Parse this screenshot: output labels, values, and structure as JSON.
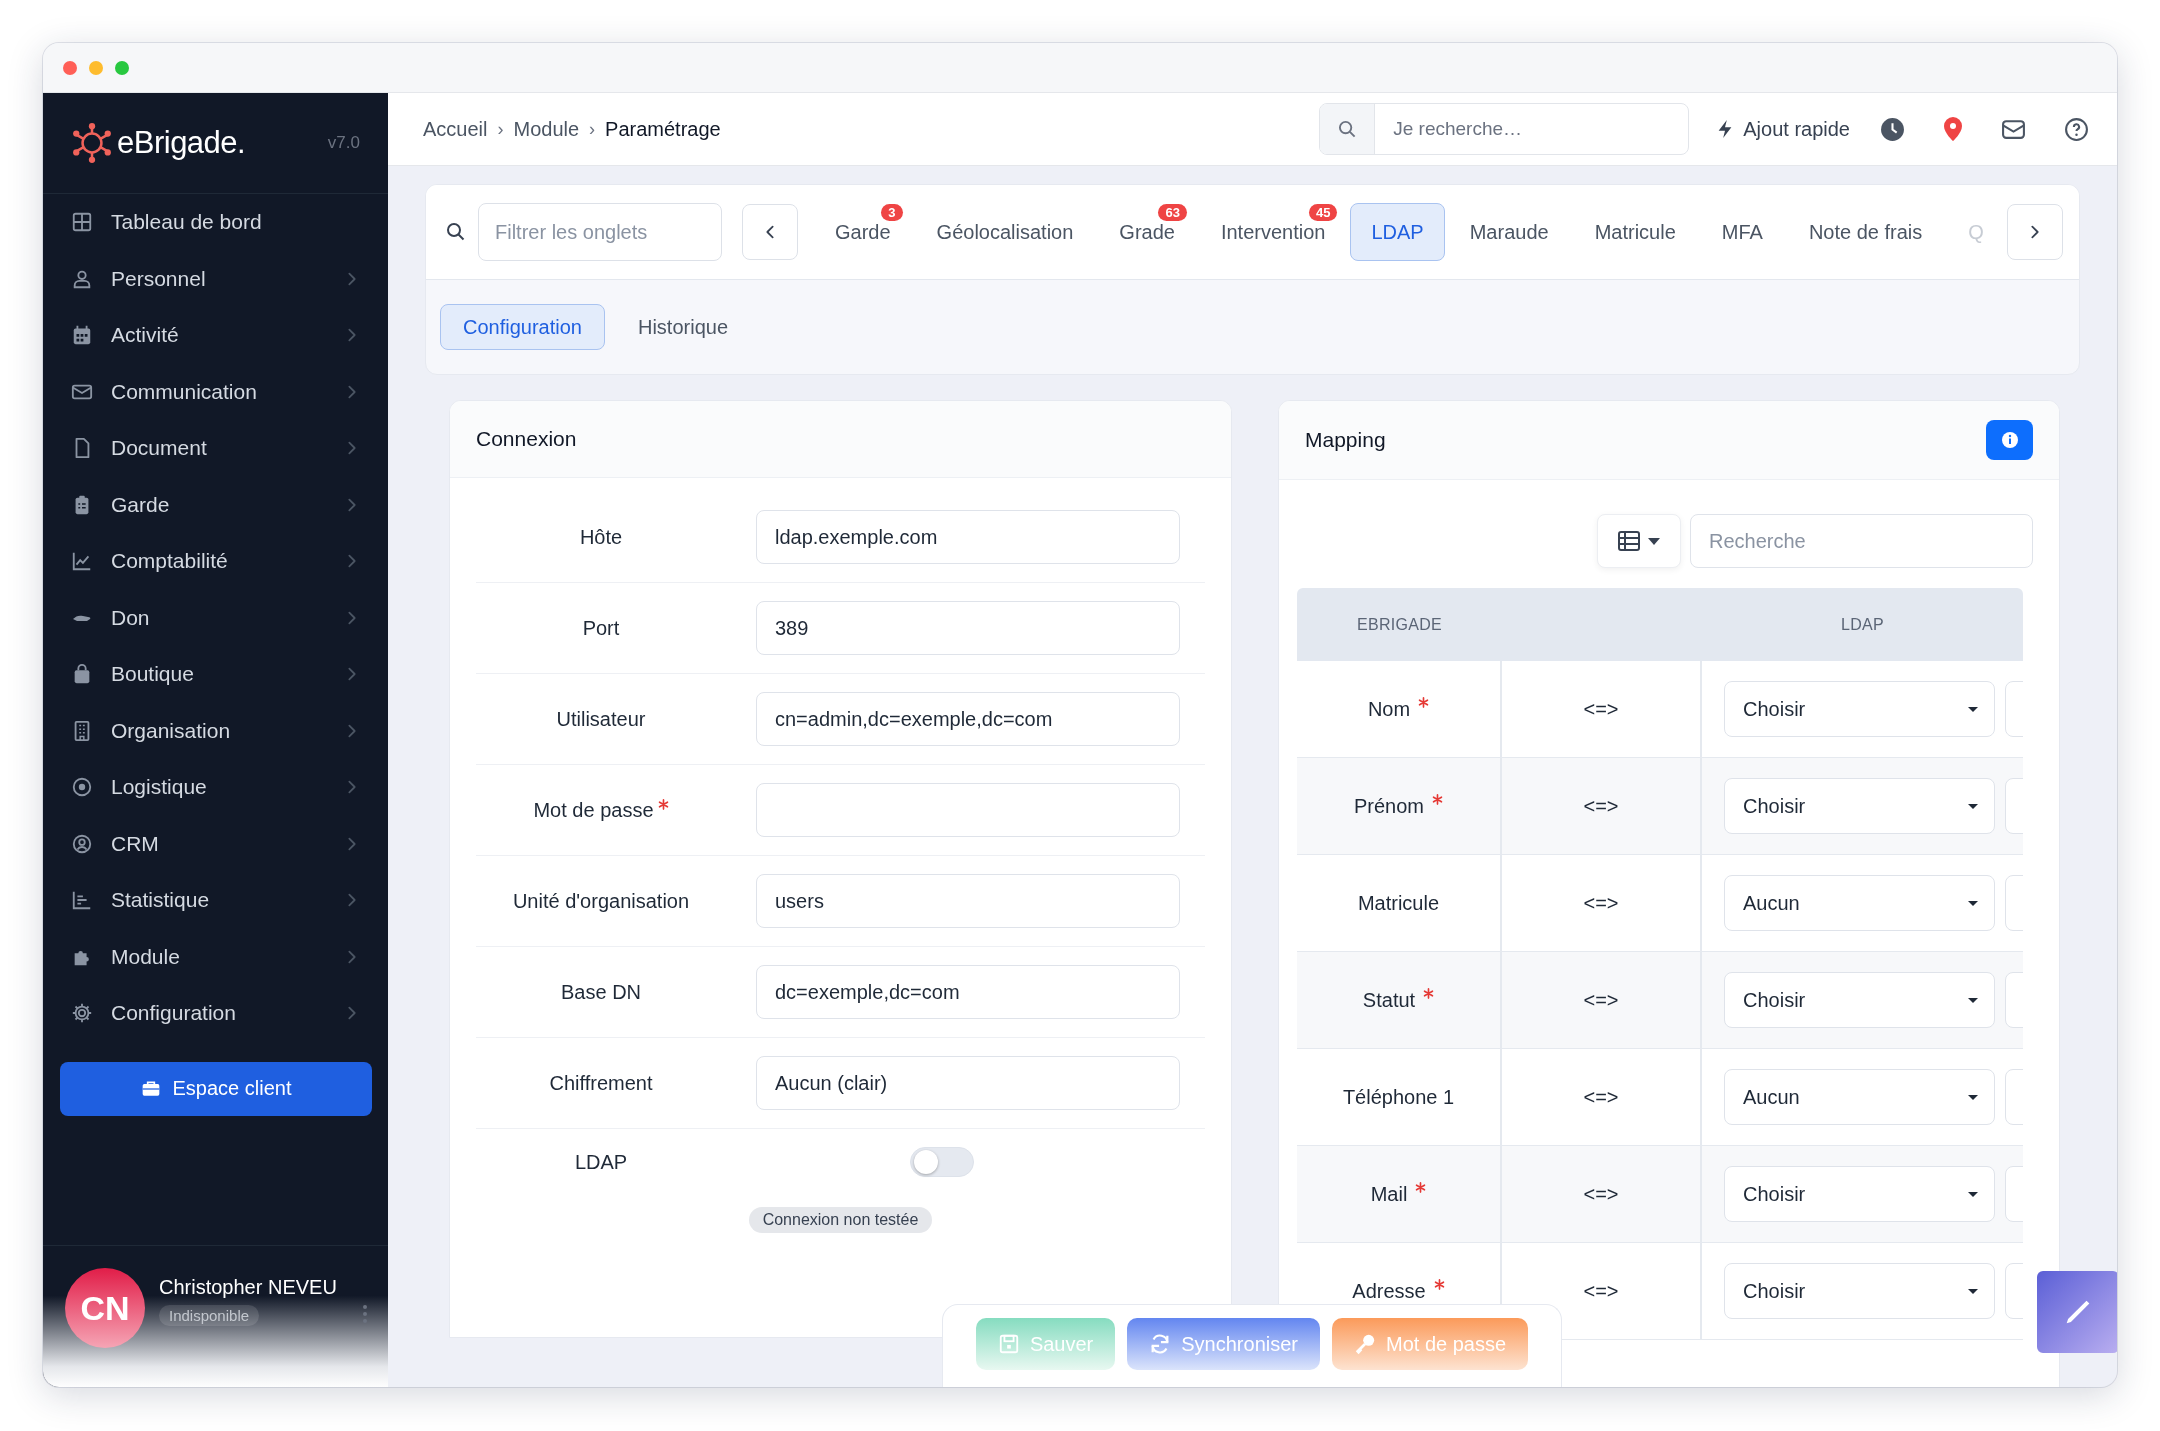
{
  "sidebar": {
    "brand": "eBrigade.",
    "version": "v7.0",
    "items": [
      {
        "label": "Tableau de bord",
        "expandable": false
      },
      {
        "label": "Personnel",
        "expandable": true
      },
      {
        "label": "Activité",
        "expandable": true
      },
      {
        "label": "Communication",
        "expandable": true
      },
      {
        "label": "Document",
        "expandable": true
      },
      {
        "label": "Garde",
        "expandable": true
      },
      {
        "label": "Comptabilité",
        "expandable": true
      },
      {
        "label": "Don",
        "expandable": true
      },
      {
        "label": "Boutique",
        "expandable": true
      },
      {
        "label": "Organisation",
        "expandable": true
      },
      {
        "label": "Logistique",
        "expandable": true
      },
      {
        "label": "CRM",
        "expandable": true
      },
      {
        "label": "Statistique",
        "expandable": true
      },
      {
        "label": "Module",
        "expandable": true
      },
      {
        "label": "Configuration",
        "expandable": true
      }
    ],
    "client_button": "Espace client",
    "user": {
      "initials": "CN",
      "name": "Christopher NEVEU",
      "status": "Indisponible"
    }
  },
  "topbar": {
    "breadcrumb": [
      {
        "label": "Accueil",
        "current": false
      },
      {
        "label": "Module",
        "current": false
      },
      {
        "label": "Paramétrage",
        "current": true
      }
    ],
    "separator": "›",
    "search": {
      "placeholder": "Je recherche…"
    },
    "quick_add": "Ajout rapide"
  },
  "module_tabs": {
    "filter": {
      "placeholder": "Filtrer les onglets"
    },
    "tabs": [
      {
        "label": "Garde",
        "badge": "3",
        "selected": false
      },
      {
        "label": "Géolocalisation",
        "selected": false
      },
      {
        "label": "Grade",
        "badge": "63",
        "selected": false
      },
      {
        "label": "Intervention",
        "badge": "45",
        "selected": false
      },
      {
        "label": "LDAP",
        "selected": true
      },
      {
        "label": "Maraude",
        "selected": false
      },
      {
        "label": "Matricule",
        "selected": false
      },
      {
        "label": "MFA",
        "selected": false
      },
      {
        "label": "Note de frais",
        "selected": false
      },
      {
        "label": "Q",
        "selected": false
      }
    ]
  },
  "sub_tabs": [
    {
      "label": "Configuration",
      "selected": true
    },
    {
      "label": "Historique",
      "selected": false
    }
  ],
  "connexion": {
    "title": "Connexion",
    "fields": [
      {
        "kind": "input",
        "label": "Hôte",
        "value": "ldap.exemple.com",
        "required": false
      },
      {
        "kind": "input",
        "label": "Port",
        "value": "389",
        "required": false
      },
      {
        "kind": "input",
        "label": "Utilisateur",
        "value": "cn=admin,dc=exemple,dc=com",
        "required": false
      },
      {
        "kind": "input",
        "label": "Mot de passe",
        "required": true
      },
      {
        "kind": "input",
        "label": "Unité d'organisation",
        "value": "users",
        "required": false
      },
      {
        "kind": "input",
        "label": "Base DN",
        "value": "dc=exemple,dc=com",
        "required": false
      },
      {
        "kind": "input",
        "label": "Chiffrement",
        "value": "Aucun (clair)",
        "required": false
      },
      {
        "kind": "toggle",
        "label": "LDAP",
        "on": false
      }
    ],
    "status": "Connexion non testée"
  },
  "mapping": {
    "title": "Mapping",
    "search": {
      "placeholder": "Recherche"
    },
    "columns": {
      "source": "EBRIGADE",
      "target": "LDAP"
    },
    "rows": [
      {
        "field": "Nom",
        "required": true,
        "link": "<=>",
        "value": "Choisir"
      },
      {
        "field": "Prénom",
        "required": true,
        "link": "<=>",
        "value": "Choisir"
      },
      {
        "field": "Matricule",
        "required": false,
        "link": "<=>",
        "value": "Aucun"
      },
      {
        "field": "Statut",
        "required": true,
        "link": "<=>",
        "value": "Choisir"
      },
      {
        "field": "Téléphone 1",
        "required": false,
        "link": "<=>",
        "value": "Aucun"
      },
      {
        "field": "Mail",
        "required": true,
        "link": "<=>",
        "value": "Choisir"
      },
      {
        "field": "Adresse",
        "required": true,
        "link": "<=>",
        "value": "Choisir"
      }
    ]
  },
  "actions": [
    {
      "kind": "save",
      "label": "Sauver"
    },
    {
      "kind": "sync",
      "label": "Synchroniser"
    },
    {
      "kind": "password",
      "label": "Mot de passe"
    }
  ]
}
